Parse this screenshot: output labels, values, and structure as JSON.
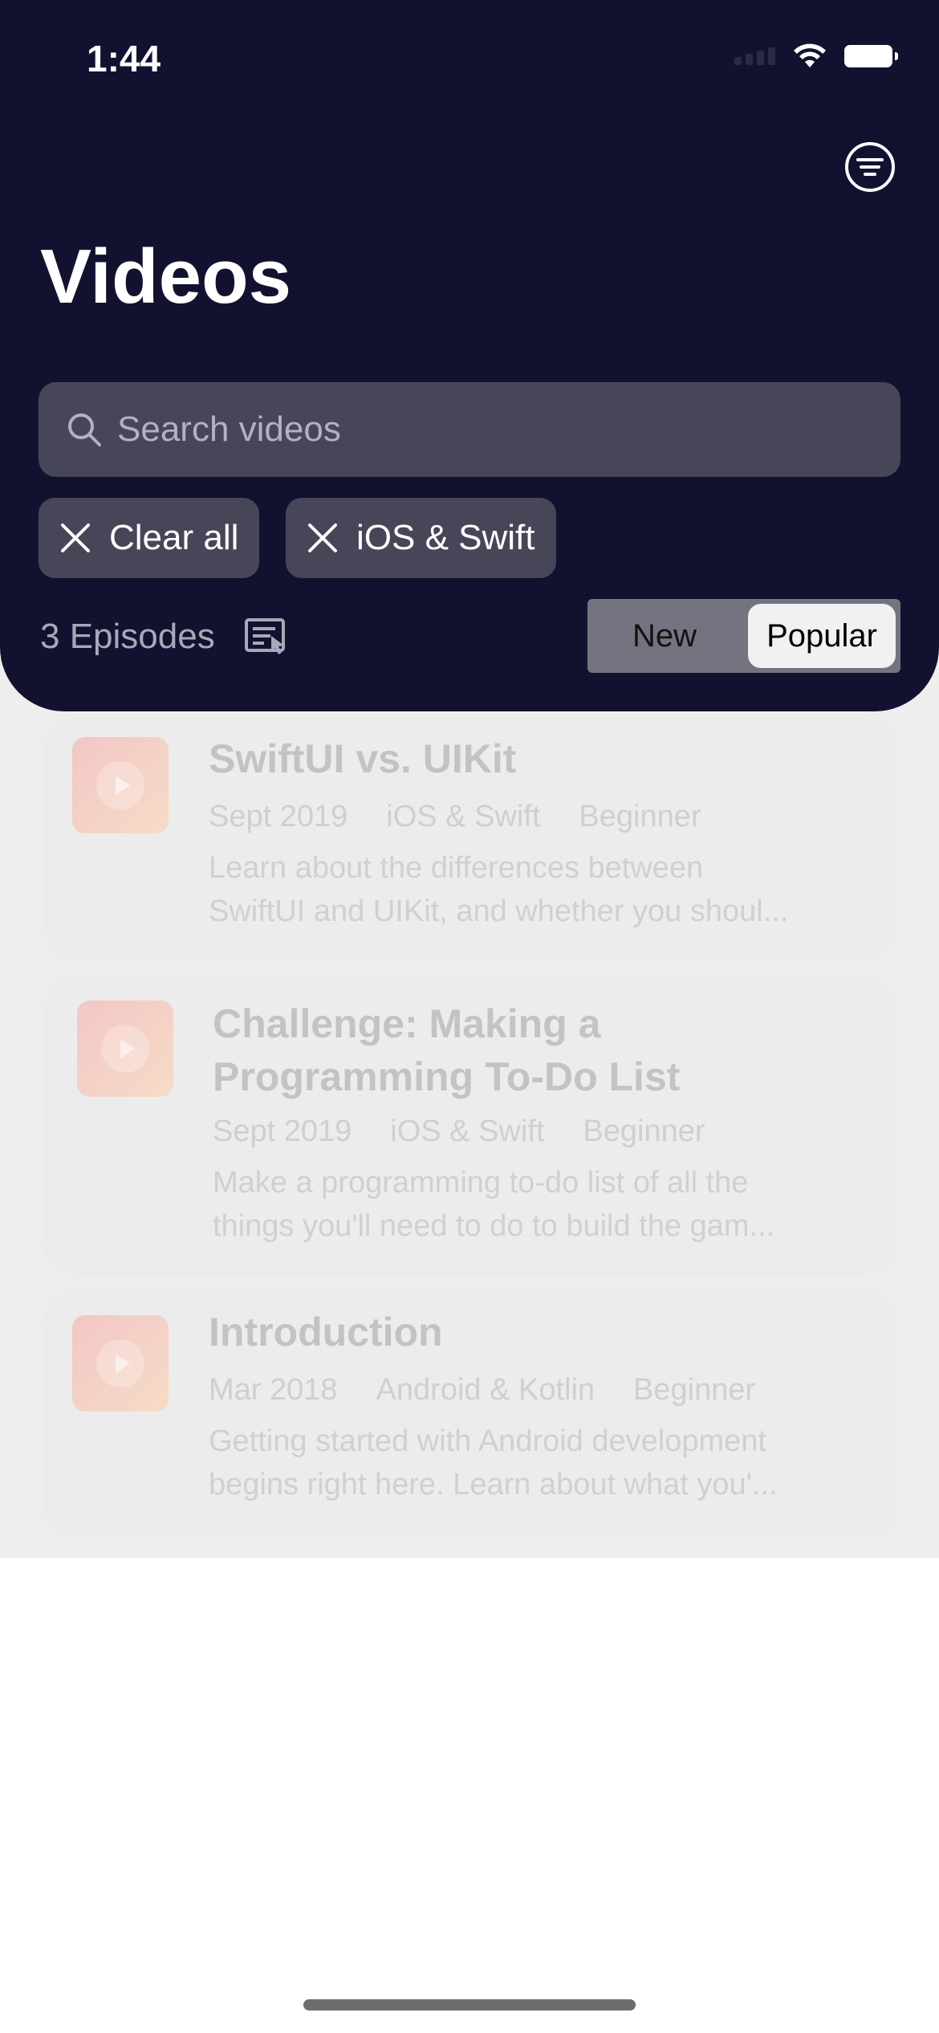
{
  "status_bar": {
    "time": "1:44"
  },
  "header": {
    "title": "Videos"
  },
  "search": {
    "placeholder": "Search videos"
  },
  "filters": [
    {
      "label": "Clear all"
    },
    {
      "label": "iOS & Swift"
    }
  ],
  "episodes_count": "3 Episodes",
  "sort": {
    "options": [
      "New",
      "Popular"
    ],
    "selected": "Popular"
  },
  "videos": [
    {
      "title": "SwiftUI vs. UIKit",
      "date": "Sept 2019",
      "domain": "iOS & Swift",
      "level": "Beginner",
      "description_line1": "Learn about the differences between",
      "description_line2": "SwiftUI and UIKit, and whether you shoul..."
    },
    {
      "title_line1": "Challenge: Making a",
      "title_line2": "Programming To-Do List",
      "date": "Sept 2019",
      "domain": "iOS & Swift",
      "level": "Beginner",
      "description_line1": "Make a programming to-do list of all the",
      "description_line2": "things you'll need to do to build the gam..."
    },
    {
      "title": "Introduction",
      "date": "Mar 2018",
      "domain": "Android & Kotlin",
      "level": "Beginner",
      "description_line1": "Getting started with Android development",
      "description_line2": "begins right here. Learn about what you'..."
    }
  ],
  "colors": {
    "header_bg": "#121230",
    "chip_bg": "#474658",
    "content_bg": "#eeeeee"
  }
}
